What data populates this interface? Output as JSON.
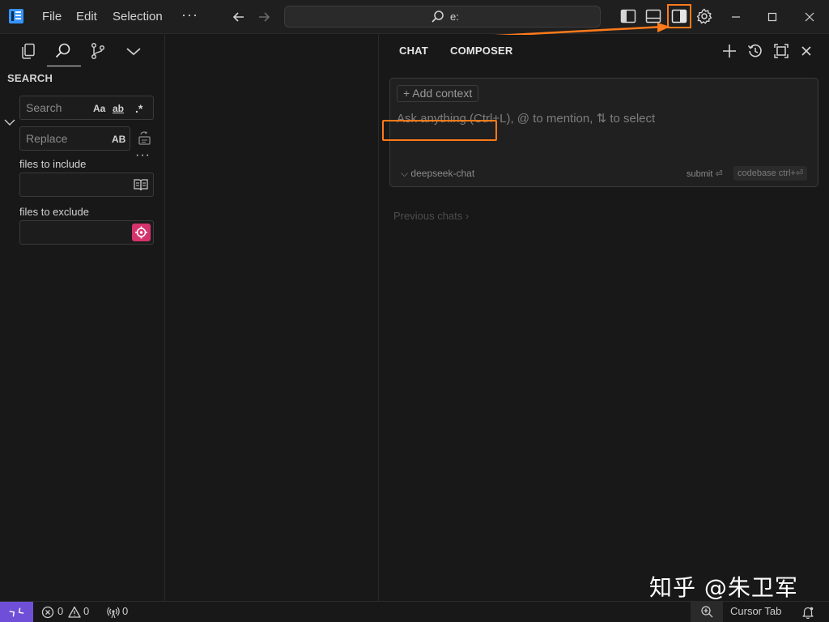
{
  "titlebar": {
    "menu": [
      "File",
      "Edit",
      "Selection"
    ],
    "more": "···",
    "command_center_text": "e:"
  },
  "sidebar": {
    "title": "SEARCH",
    "search": {
      "placeholder": "Search",
      "value": "",
      "opt_case": "Aa",
      "opt_word": "ab",
      "opt_regex": ".*"
    },
    "replace": {
      "placeholder": "Replace",
      "value": "",
      "opt_preserve": "AB"
    },
    "more": "···",
    "include_label": "files to include",
    "exclude_label": "files to exclude"
  },
  "chat": {
    "tabs": [
      "CHAT",
      "COMPOSER"
    ],
    "add_context": "+ Add context",
    "placeholder": "Ask anything (Ctrl+L), @ to mention, ⇅ to select",
    "model": "⌵ deepseek-chat",
    "submit": "submit ⏎",
    "codebase": "codebase ctrl+⏎",
    "previous_chats": "Previous chats ›"
  },
  "watermark": "知乎 @朱卫军",
  "statusbar": {
    "errors": "0",
    "warnings": "0",
    "ports": "0",
    "cursor_tab": "Cursor Tab"
  },
  "colors": {
    "accent": "#6f4fd8",
    "annotation": "#ff7a1a",
    "exclude_button": "#d6336c",
    "logo": "#3794ff"
  }
}
